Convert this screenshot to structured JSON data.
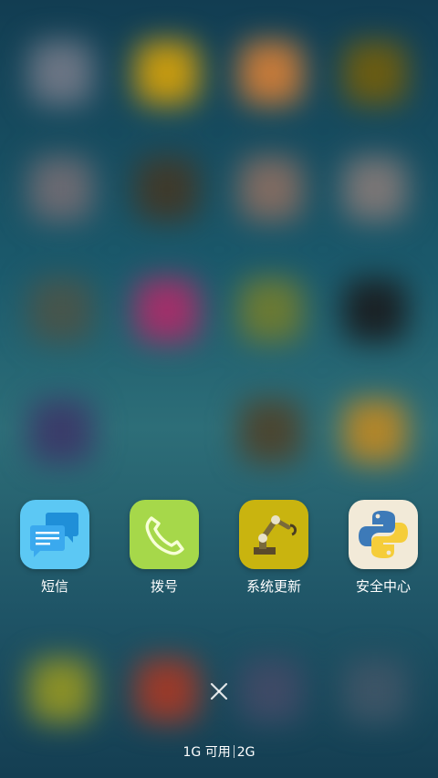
{
  "recent_apps": [
    {
      "label": "短信",
      "icon": "messages-icon",
      "color": "#5cc8f4"
    },
    {
      "label": "拨号",
      "icon": "phone-icon",
      "color": "#a6d84a"
    },
    {
      "label": "系统更新",
      "icon": "robot-arm-icon",
      "color": "#c9b40f"
    },
    {
      "label": "安全中心",
      "icon": "python-icon",
      "color": "#f2ead8"
    }
  ],
  "close_all": {
    "icon": "close-icon"
  },
  "memory": {
    "free": "1G 可用",
    "total": "2G"
  },
  "colors": {
    "background": "#1b5a6c",
    "text": "#ffffff"
  }
}
